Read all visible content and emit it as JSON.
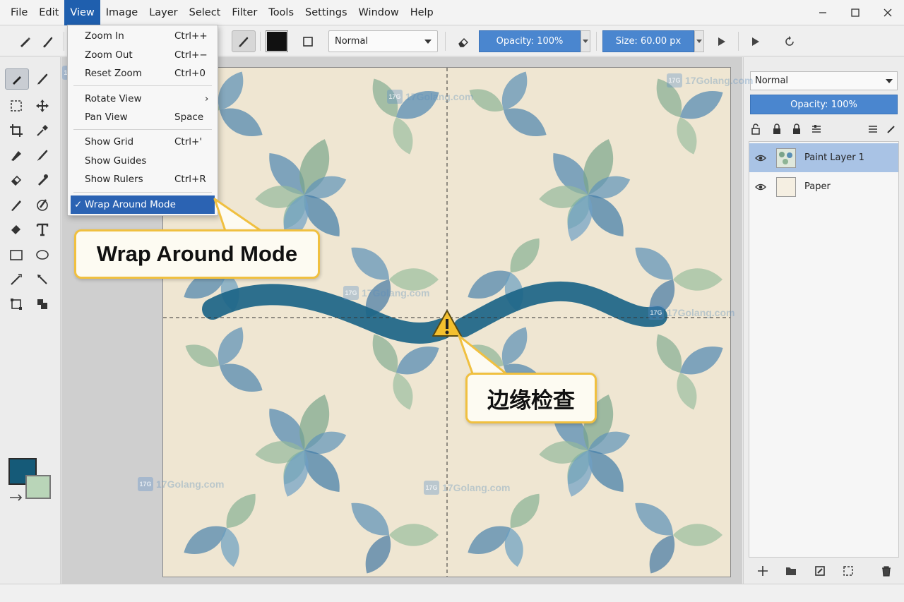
{
  "menubar": {
    "items": [
      "File",
      "Edit",
      "View",
      "Image",
      "Layer",
      "Select",
      "Filter",
      "Tools",
      "Settings",
      "Window",
      "Help"
    ],
    "active": "View"
  },
  "toolbar": {
    "blend_mode": "Normal",
    "opacity": "Opacity: 100%",
    "size": "Size: 60.00 px",
    "fg_color": "#111111"
  },
  "view_menu": {
    "items": [
      {
        "label": "Zoom In",
        "shortcut": "Ctrl++"
      },
      {
        "label": "Zoom Out",
        "shortcut": "Ctrl+−"
      },
      {
        "label": "Reset Zoom",
        "shortcut": "Ctrl+0"
      },
      {
        "label": "Rotate View",
        "shortcut": "›"
      },
      {
        "label": "Pan View",
        "shortcut": "Space"
      },
      {
        "label": "Show Grid",
        "shortcut": "Ctrl+'"
      },
      {
        "label": "Show Guides",
        "shortcut": ""
      },
      {
        "label": "Show Rulers",
        "shortcut": "Ctrl+R"
      },
      {
        "label": "Wrap Around Mode",
        "shortcut": "",
        "checked": "✓"
      }
    ]
  },
  "callouts": {
    "wrap_mode": "Wrap Around Mode",
    "edge_check": "边缘检查"
  },
  "colors": {
    "foreground": "#155a78",
    "background": "#b9d5b8",
    "accent": "#4a86cf",
    "menu_highlight": "#2b63b3"
  },
  "right_panel": {
    "blend_mode": "Normal",
    "opacity": "Opacity: 100%",
    "layers": [
      {
        "name": "Paint Layer 1",
        "selected": true
      },
      {
        "name": "Paper",
        "selected": false
      }
    ]
  },
  "watermarks": {
    "text": "17Golang.com",
    "logo": "17G"
  }
}
